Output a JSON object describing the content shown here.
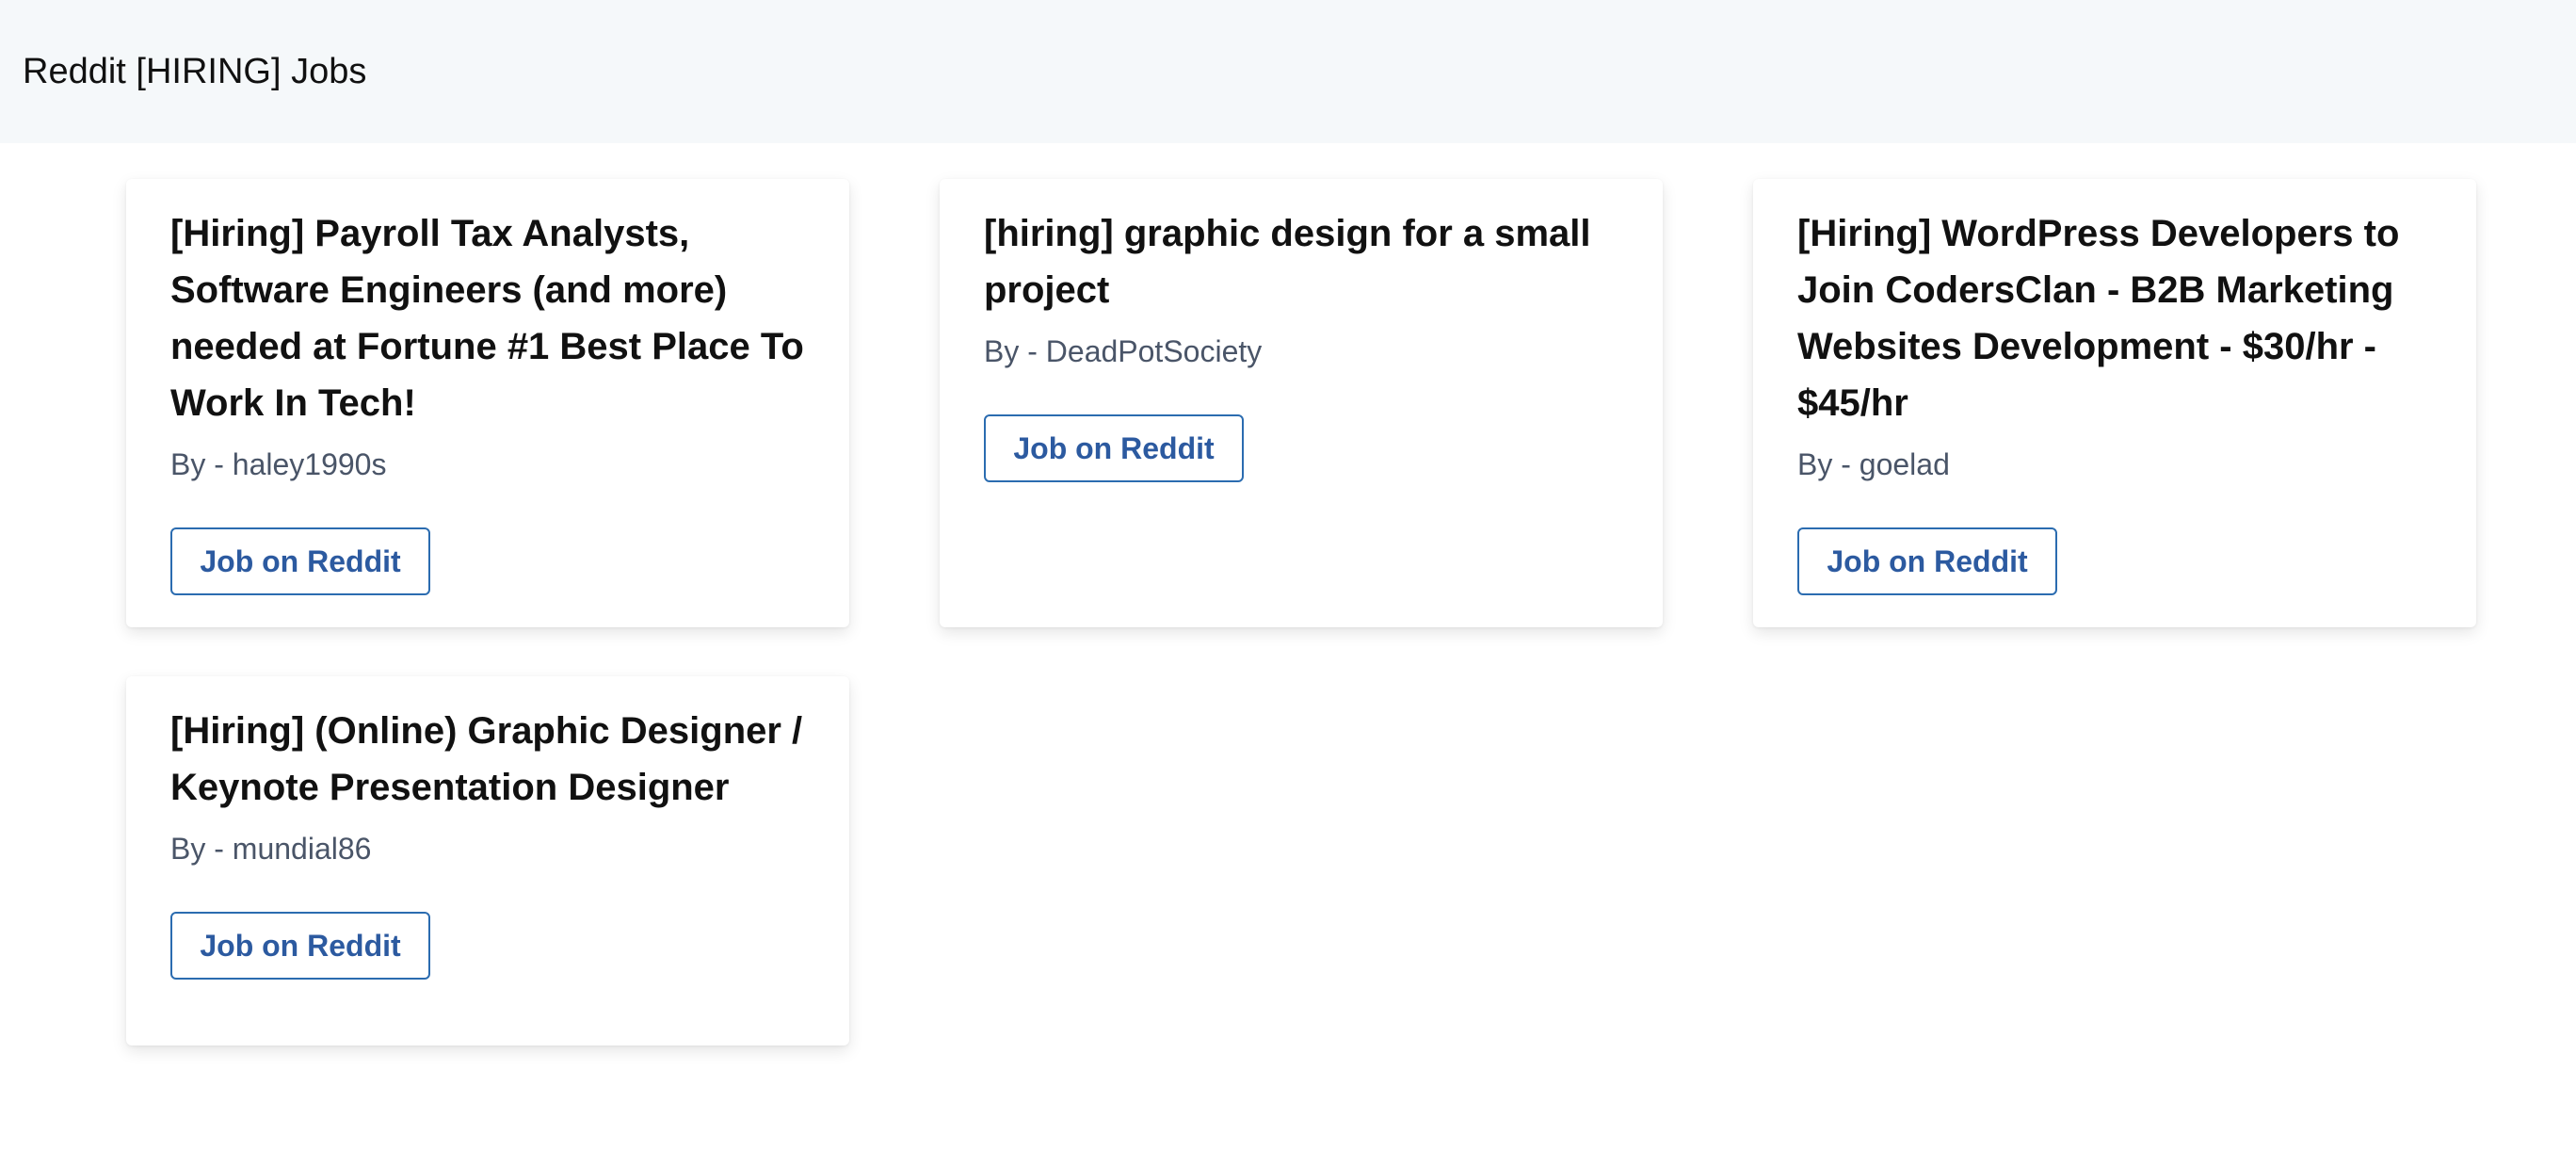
{
  "header": {
    "title": "Reddit [HIRING] Jobs"
  },
  "jobs": [
    {
      "title": "[Hiring] Payroll Tax Analysts, Software Engineers (and more) needed at Fortune #1 Best Place To Work In Tech!",
      "author": "By - haley1990s",
      "button_label": "Job on Reddit"
    },
    {
      "title": "[hiring] graphic design for a small project",
      "author": "By - DeadPotSociety",
      "button_label": "Job on Reddit"
    },
    {
      "title": "[Hiring] WordPress Developers to Join CodersClan - B2B Marketing Websites Development - $30/hr - $45/hr",
      "author": "By - goelad",
      "button_label": "Job on Reddit"
    },
    {
      "title": "[Hiring] (Online) Graphic Designer / Keynote Presentation Designer",
      "author": "By - mundial86",
      "button_label": "Job on Reddit"
    }
  ],
  "colors": {
    "header_bg": "#f5f8fa",
    "button_border": "#2b6cb0",
    "button_text": "#2c5aa0",
    "author_text": "#4a5568"
  }
}
